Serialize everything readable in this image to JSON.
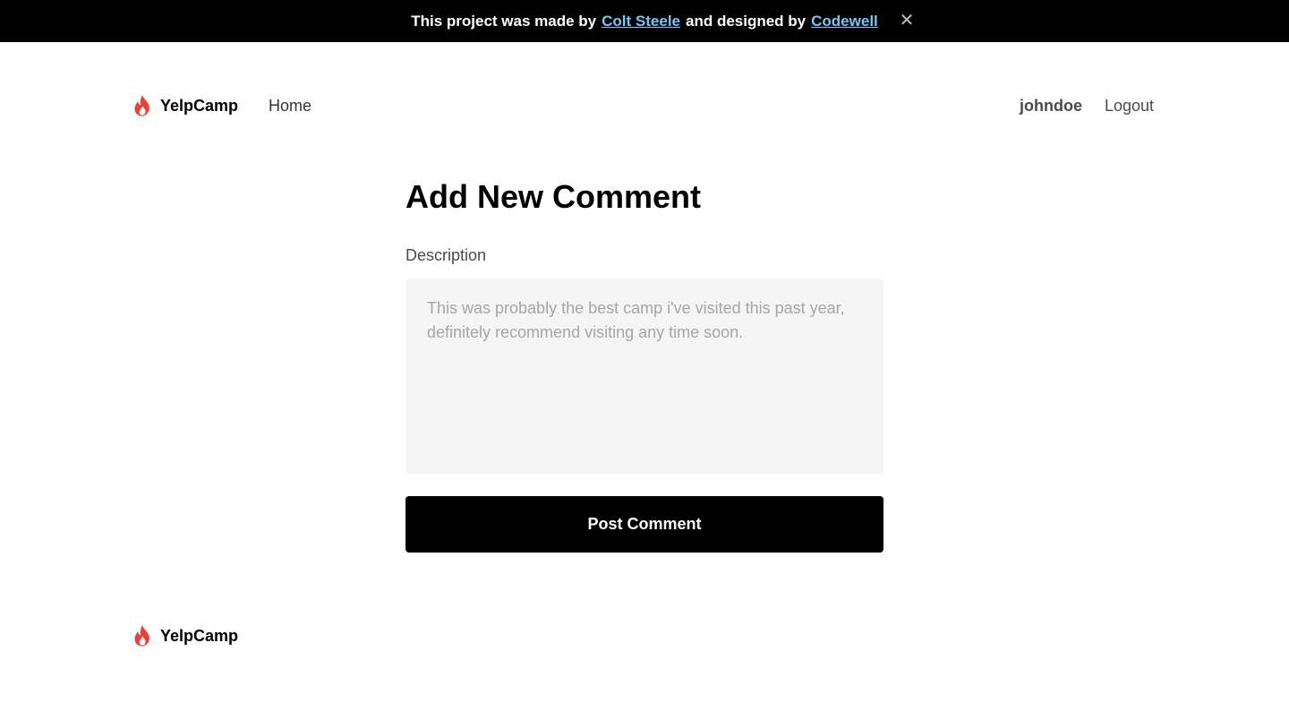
{
  "banner": {
    "prefix": "This project was made by",
    "author_link": "Colt Steele",
    "middle": "and designed by",
    "designer_link": "Codewell",
    "close_icon": "close-icon",
    "close_glyph": "✕"
  },
  "header": {
    "logo_icon": "flame-icon",
    "brand": "YelpCamp",
    "nav_home": "Home",
    "username": "johndoe",
    "logout": "Logout"
  },
  "form": {
    "title": "Add New Comment",
    "description_label": "Description",
    "description_placeholder": "This was probably the best camp i've visited this past year, definitely recommend visiting any time soon.",
    "description_value": "",
    "submit_label": "Post Comment"
  },
  "footer": {
    "logo_icon": "flame-icon",
    "brand": "YelpCamp"
  },
  "colors": {
    "banner_bg": "#000000",
    "banner_link": "#7cc4ee",
    "flame": "#e8423a",
    "button_bg": "#000000",
    "textarea_bg": "#f5f5f5"
  }
}
